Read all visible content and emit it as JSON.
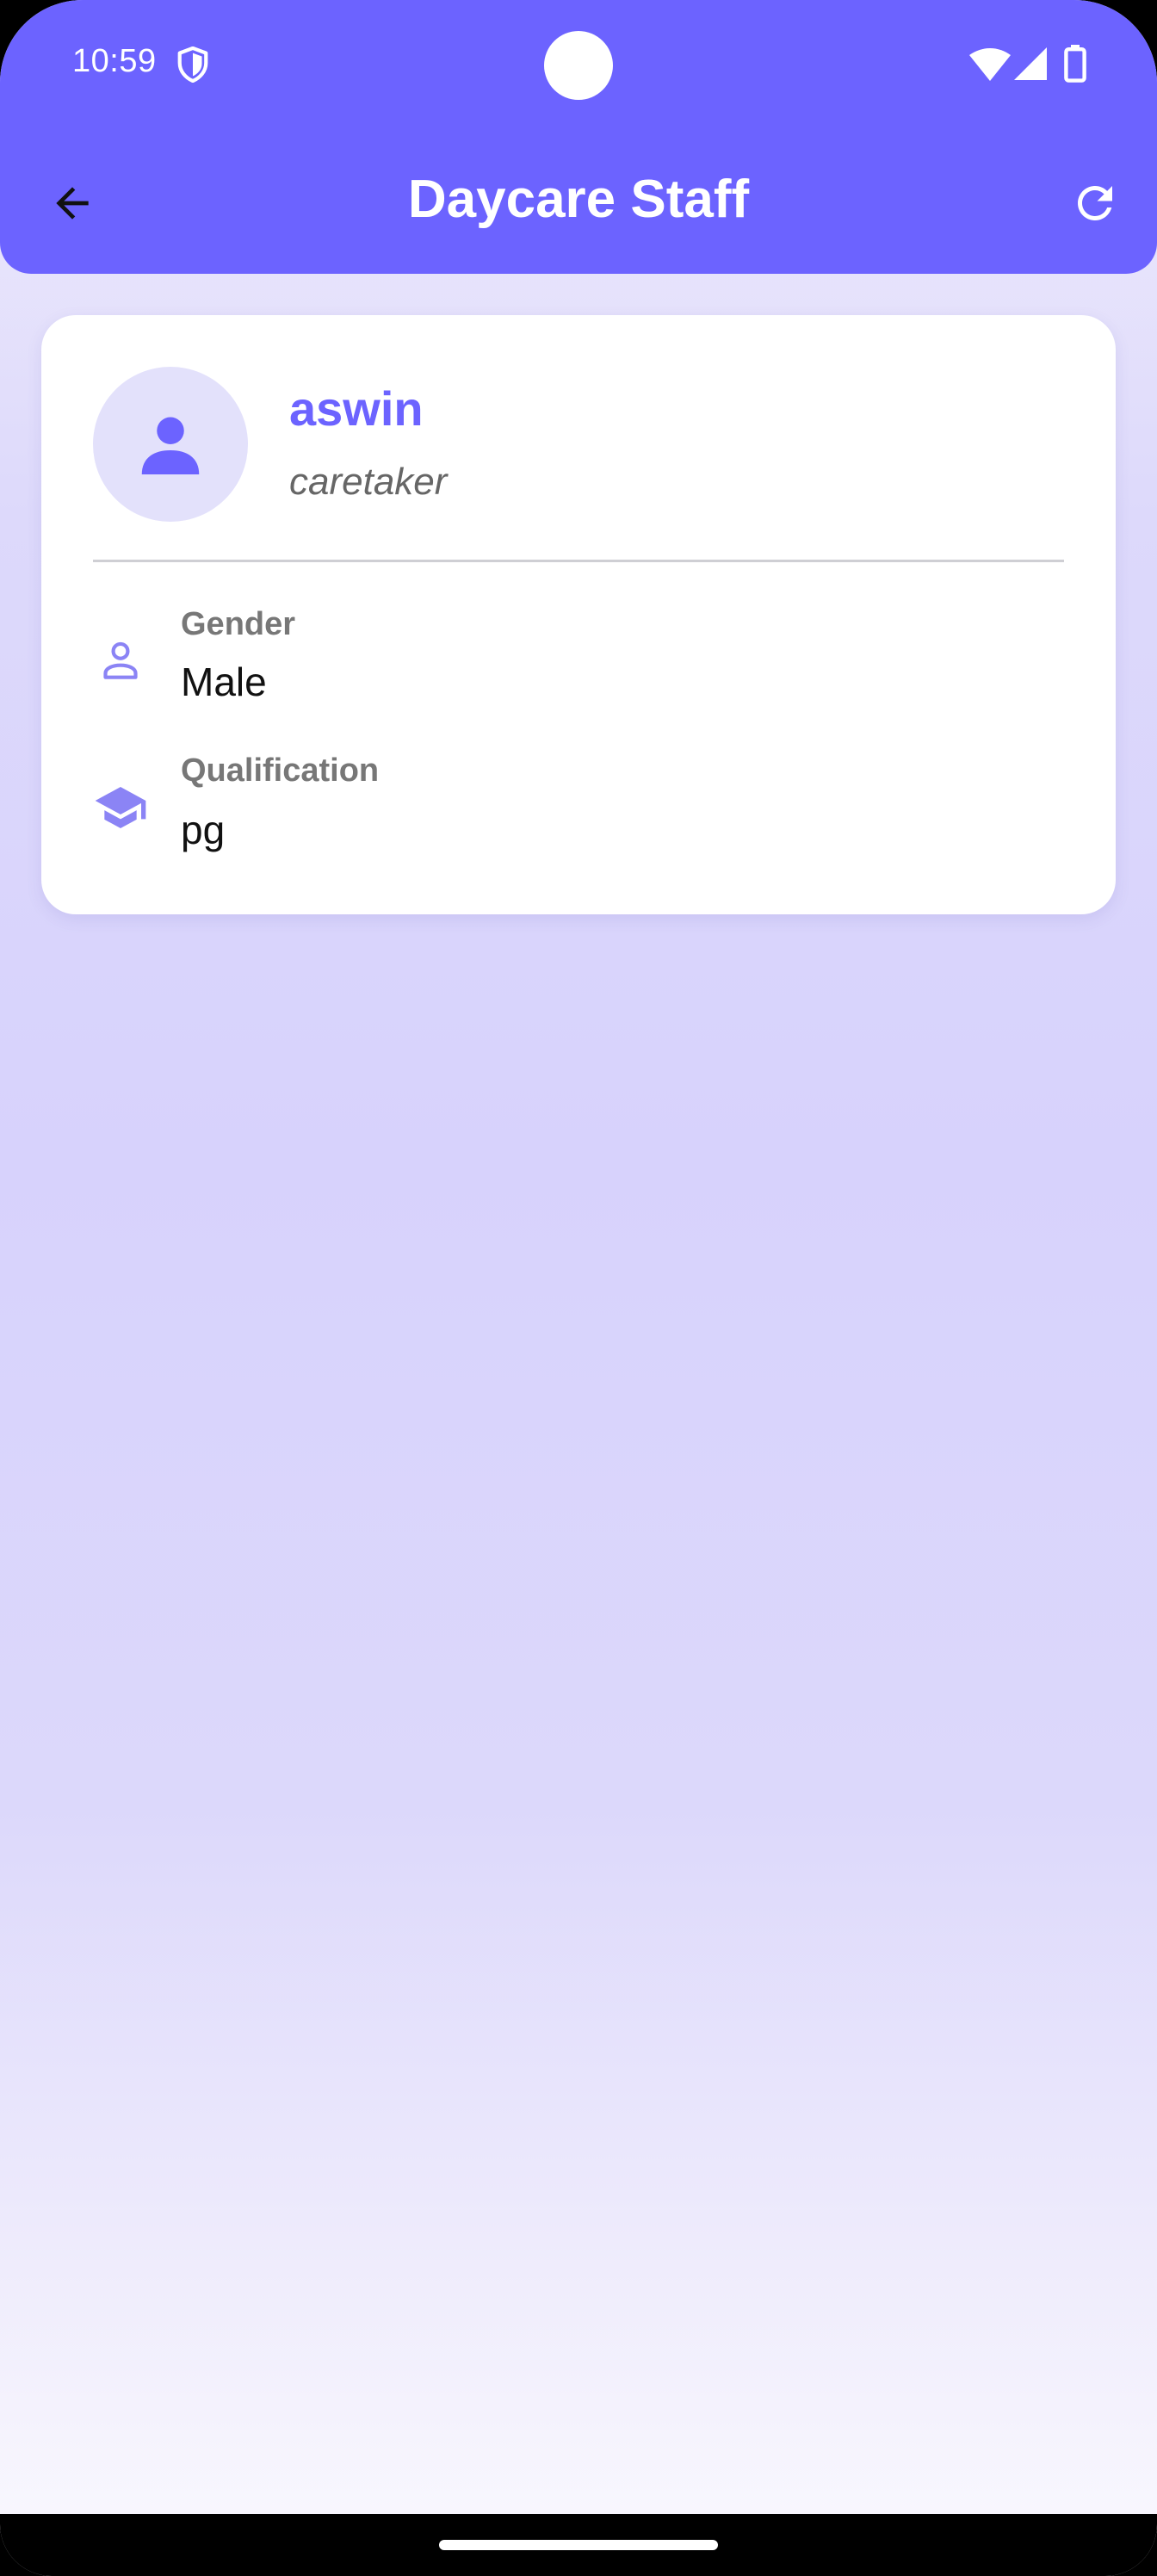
{
  "status_bar": {
    "time": "10:59"
  },
  "header": {
    "title": "Daycare Staff"
  },
  "staff": {
    "name": "aswin",
    "role": "caretaker",
    "details": [
      {
        "label": "Gender",
        "value": "Male",
        "icon": "person-outline-icon"
      },
      {
        "label": "Qualification",
        "value": "pg",
        "icon": "graduation-cap-icon"
      }
    ]
  },
  "colors": {
    "primary": "#6c63ff",
    "icon_accent": "#8b84f5",
    "avatar_bg": "#e3e1fb"
  }
}
